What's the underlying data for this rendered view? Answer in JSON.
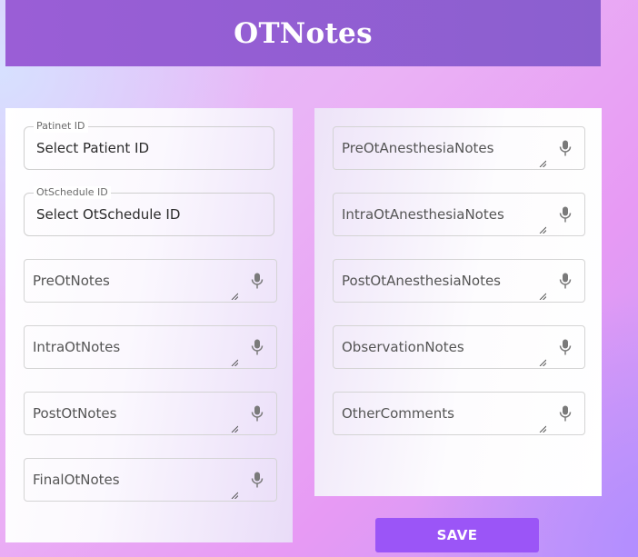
{
  "header": {
    "title": "OTNotes"
  },
  "left_panel": {
    "patient_id": {
      "legend": "Patinet ID",
      "value": "Select Patient ID"
    },
    "schedule_id": {
      "legend": "OtSchedule ID",
      "value": "Select OtSchedule ID"
    },
    "notes": [
      {
        "placeholder": "PreOtNotes"
      },
      {
        "placeholder": "IntraOtNotes"
      },
      {
        "placeholder": "PostOtNotes"
      },
      {
        "placeholder": "FinalOtNotes"
      }
    ]
  },
  "right_panel": {
    "notes": [
      {
        "placeholder": "PreOtAnesthesiaNotes"
      },
      {
        "placeholder": "IntraOtAnesthesiaNotes"
      },
      {
        "placeholder": "PostOtAnesthesiaNotes"
      },
      {
        "placeholder": "ObservationNotes"
      },
      {
        "placeholder": "OtherComments"
      }
    ]
  },
  "actions": {
    "save_label": "SAVE"
  },
  "colors": {
    "header_bg": "#8b5fcf",
    "save_button_bg": "#9b55f7"
  },
  "icons": {
    "dictation": "microphone-icon",
    "resize": "resize-handle-icon"
  }
}
